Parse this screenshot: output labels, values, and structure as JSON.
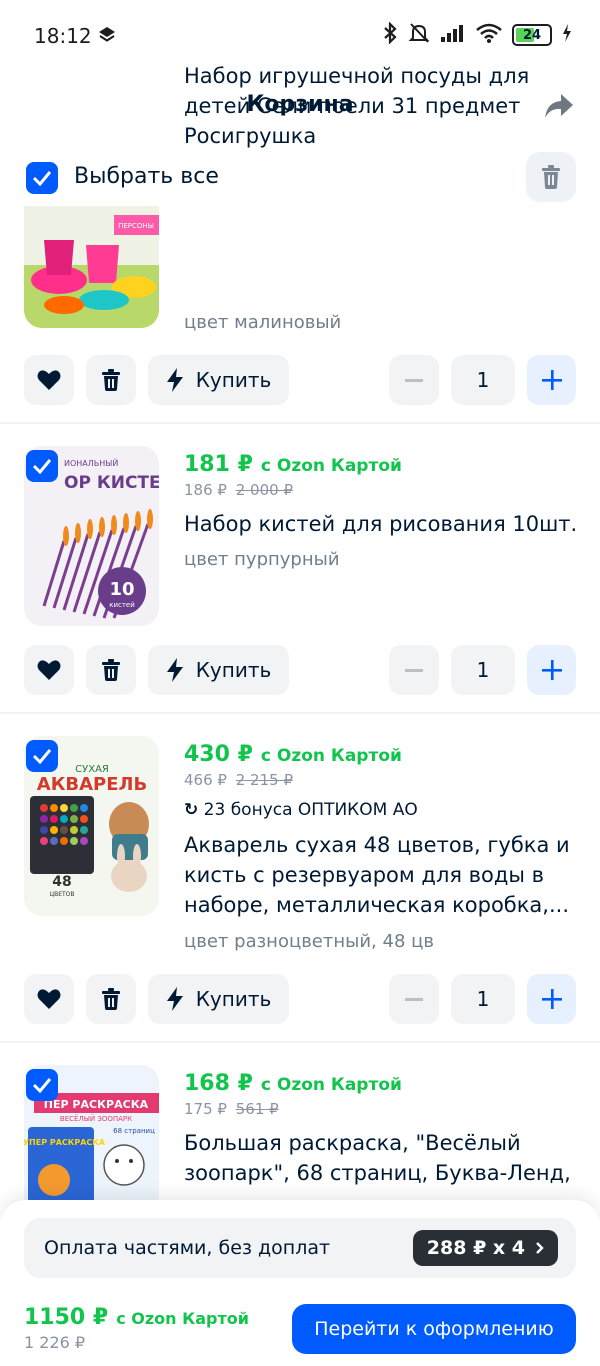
{
  "status_bar": {
    "time": "18:12",
    "battery": "24"
  },
  "header": {
    "title": "Корзина"
  },
  "select_all": {
    "label": "Выбрать все"
  },
  "items": [
    {
      "name": "Набор игрушечной посуды для детей Сели поели 31 предмет Росигрушка",
      "color": "цвет малиновый",
      "thumb_text": "ПЕРСОНЫ",
      "quantity": "1",
      "buy_label": "Купить"
    },
    {
      "price": "181 ₽",
      "price_note": "с Ozon Картой",
      "old_price": "186 ₽",
      "strike_price": "2 000 ₽",
      "name": "Набор кистей для рисования 10шт.",
      "color": "цвет пурпурный",
      "thumb_title": "ОР КИСТЕЙ",
      "thumb_top": "ИОНАЛЬНЫЙ",
      "thumb_badge_num": "10",
      "thumb_badge_text": "кистей",
      "quantity": "1",
      "buy_label": "Купить"
    },
    {
      "price": "430 ₽",
      "price_note": "с Ozon Картой",
      "old_price": "466 ₽",
      "strike_price": "2 215 ₽",
      "bonus": "23 бонуса ОПТИКОМ АО",
      "name": "Акварель сухая 48 цветов, губка и кисть с резервуаром для воды в наборе, металлическая коробка,...",
      "color": "цвет разноцветный, 48 цв",
      "thumb_top": "СУХАЯ",
      "thumb_title": "АКВАРЕЛЬ",
      "thumb_num": "48",
      "thumb_sub": "ЦВЕТОВ",
      "quantity": "1",
      "buy_label": "Купить"
    },
    {
      "price": "168 ₽",
      "price_note": "с Ozon Картой",
      "old_price": "175 ₽",
      "strike_price": "561 ₽",
      "name": "Большая раскраска, \"Весёлый зоопарк\", 68 страниц, Буква-Ленд,",
      "thumb_title": "ПЕР РАСКРАСКА",
      "thumb_sub": "ВЕСЁЛЫЙ ЗООПАРК",
      "thumb_pages": "68 страниц",
      "thumb_book": "СУПЕР РАСКРАСКА"
    }
  ],
  "installments": {
    "text": "Оплата частями, без доплат",
    "pill": "288 ₽ x 4"
  },
  "total": {
    "price": "1150 ₽",
    "note": "с Ozon Картой",
    "old": "1 226 ₽"
  },
  "checkout_label": "Перейти к оформлению"
}
